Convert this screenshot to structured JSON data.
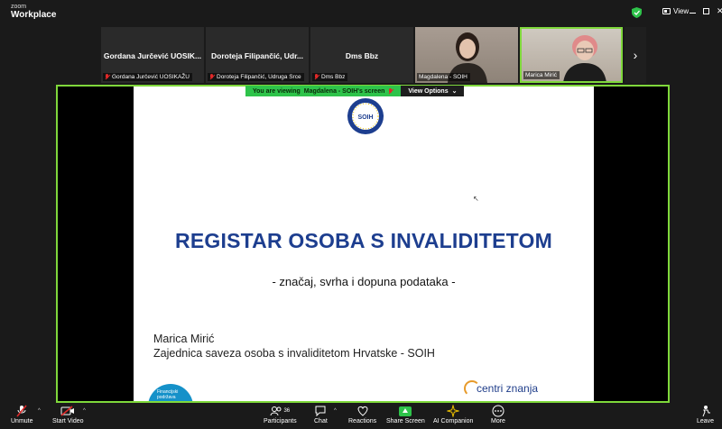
{
  "brand": {
    "small": "zoom",
    "big": "Workplace"
  },
  "topbar": {
    "view_label": "View"
  },
  "participants": [
    {
      "big_name": "Gordana Jurčević UOSIK...",
      "label": "Gordana Jurčević UOSIKAŽU",
      "muted": true
    },
    {
      "big_name": "Doroteja Filipančić, Udr...",
      "label": "Doroteja Filipančić, Udruga Srce",
      "muted": true
    },
    {
      "big_name": "Dms Bbz",
      "label": "Dms Bbz",
      "muted": true
    },
    {
      "big_name": "",
      "label": "Magdalena - SOIH",
      "muted": false
    },
    {
      "big_name": "",
      "label": "Marica Mirić",
      "muted": false
    }
  ],
  "viewing_bar": {
    "prefix": "You are viewing",
    "name": "Magdalena - SOIH's screen",
    "options_label": "View Options"
  },
  "slide": {
    "logo_text": "SOIH",
    "title": "REGISTAR OSOBA S INVALIDITETOM",
    "subtitle": "- značaj, svrha i dopuna podataka -",
    "presenter_name": "Marica Mirić",
    "presenter_org": "Zajednica saveza osoba s invaliditetom Hrvatske - SOIH",
    "badge_text": "Financijski podržava",
    "footer_logo": "centri znanja"
  },
  "toolbar": {
    "unmute": "Unmute",
    "start_video": "Start Video",
    "participants": "Participants",
    "participants_count": "36",
    "chat": "Chat",
    "reactions": "Reactions",
    "share_screen": "Share Screen",
    "ai_companion": "AI Companion",
    "more": "More",
    "leave": "Leave"
  },
  "colors": {
    "accent_green": "#7fd83b",
    "title_blue": "#1d3e8f",
    "share_green": "#2ec34a",
    "mute_red": "#e02828"
  }
}
